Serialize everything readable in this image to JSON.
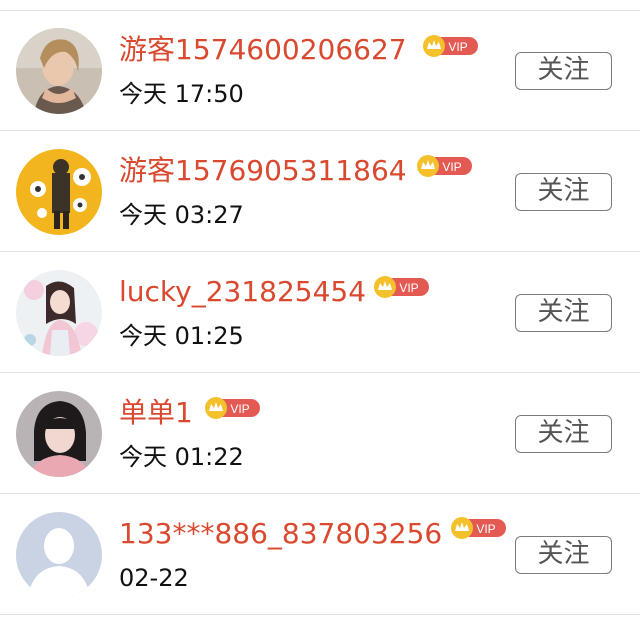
{
  "vip_label": "VIP",
  "follow_label": "关注",
  "colors": {
    "name": "#d9492f",
    "vip_badge": "#e35a52",
    "crown": "#f4c02b",
    "divider": "#e2e2e2"
  },
  "users": [
    {
      "name": "游客1574600206627",
      "time": "今天 17:50"
    },
    {
      "name": "游客1576905311864",
      "time": "今天 03:27"
    },
    {
      "name": "lucky_231825454",
      "time": "今天 01:25"
    },
    {
      "name": "单单1",
      "time": "今天 01:22"
    },
    {
      "name": "133***886_837803256",
      "time": "02-22"
    }
  ]
}
